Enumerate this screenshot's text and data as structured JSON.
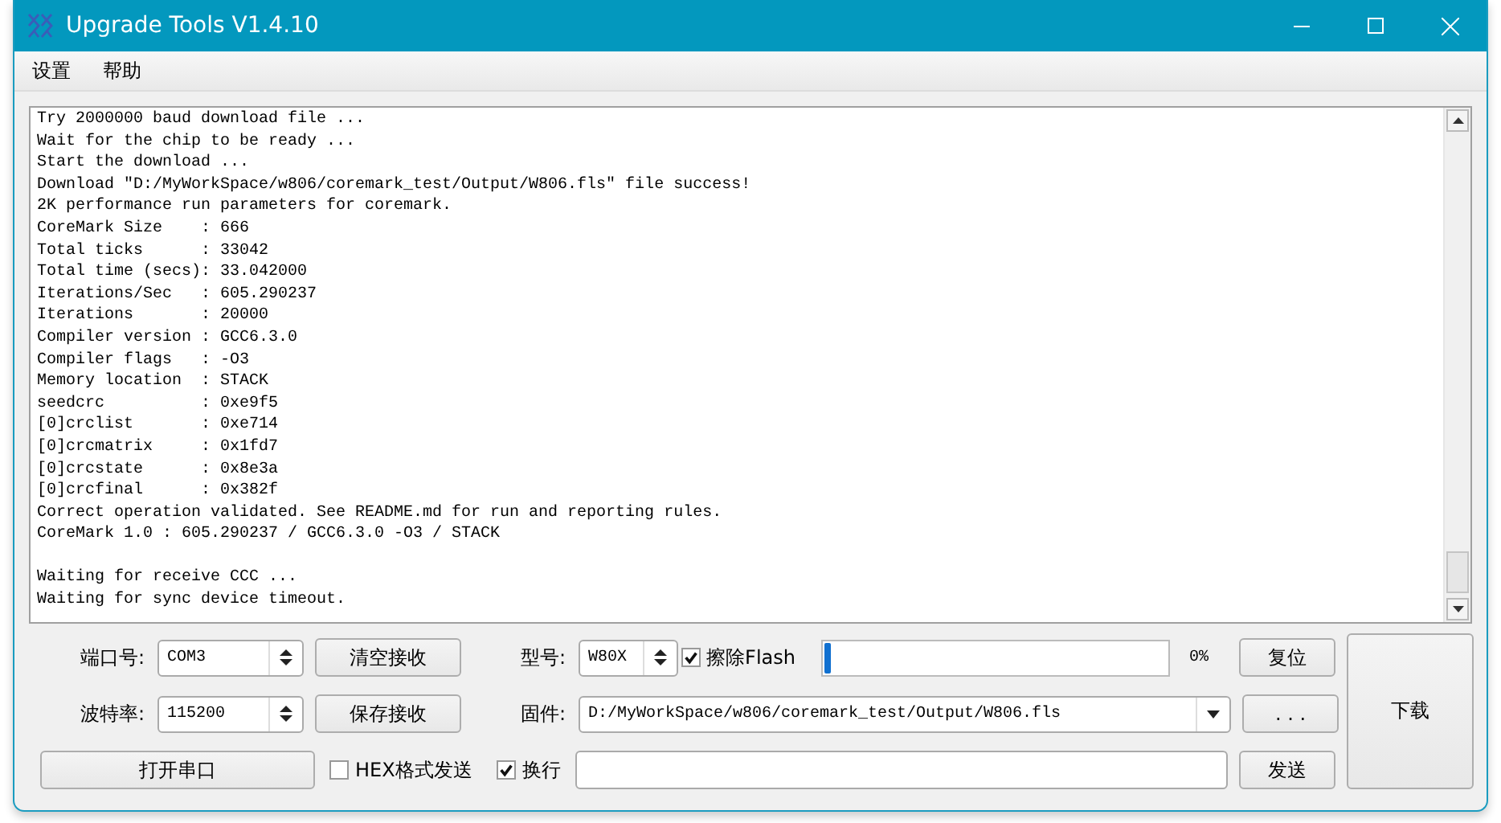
{
  "window": {
    "title": "Upgrade Tools V1.4.10"
  },
  "menu": [
    {
      "label": "设置"
    },
    {
      "label": "帮助"
    }
  ],
  "log": {
    "blocks": [
      {
        "lines": [
          "Try 2000000 baud download file ...",
          "Wait for the chip to be ready ...",
          "Start the download ...",
          "Download \"D:/MyWorkSpace/w806/coremark_test/Output/W806.fls\" file success!",
          "2K performance run parameters for coremark.",
          "CoreMark Size    : 666",
          "Total ticks      : 33042",
          "Total time (secs): 33.042000",
          "Iterations/Sec   : 605.290237",
          "Iterations       : 20000",
          "Compiler version : GCC6.3.0",
          "Compiler flags   : -O3",
          "Memory location  : STACK",
          "seedcrc          : 0xe9f5",
          "[0]crclist       : 0xe714",
          "[0]crcmatrix     : 0x1fd7",
          "[0]crcstate      : 0x8e3a",
          "[0]crcfinal      : 0x382f",
          "Correct operation validated. See README.md for run and reporting rules.",
          "CoreMark 1.0 : 605.290237 / GCC6.3.0 -O3 / STACK"
        ]
      },
      {
        "lines": [
          "Waiting for receive CCC ...",
          "Waiting for sync device timeout."
        ]
      }
    ]
  },
  "controls": {
    "port": {
      "label": "端口号:",
      "value": "COM3"
    },
    "clear_button": "清空接收",
    "model": {
      "label": "型号:",
      "value": "W80X"
    },
    "erase_flash": {
      "label": "擦除Flash",
      "checked": true
    },
    "progress": {
      "level": 0,
      "reading": "0%"
    },
    "reset_button": "复位",
    "download_button": "下载",
    "baud": {
      "label": "波特率:",
      "value": "115200"
    },
    "save_button": "保存接收",
    "firmware": {
      "label": "固件:",
      "value": "D:/MyWorkSpace/w806/coremark_test/Output/W806.fls"
    },
    "browse_button": ". . .",
    "open_port_button": "打开串口",
    "hex_send": {
      "label": "HEX格式发送",
      "checked": false
    },
    "newline": {
      "label": "换行",
      "checked": true
    },
    "send_button": "发送"
  }
}
